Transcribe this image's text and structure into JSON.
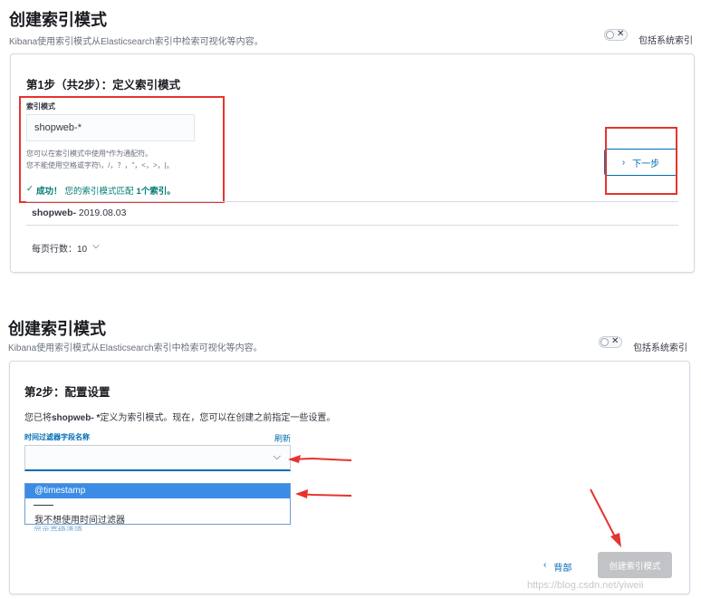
{
  "section1": {
    "title": "创建索引模式",
    "subtitle": "Kibana使用索引模式从Elasticsearch索引中检索可视化等内容。",
    "include_system_label": "包括系统索引",
    "step_title": "第1步（共2步）：定义索引模式",
    "field_label": "索引模式",
    "input_value": "shopweb-*",
    "help_line1": "您可以在索引模式中使用*作为通配符。",
    "help_line2": "您不能使用空格或字符\\，/，？，\"，<，>，|。",
    "success_prefix": "成功！",
    "success_text": "您的索引模式匹配",
    "success_bold": "1个索引。",
    "next_button": "下一步",
    "match_name": "shopweb-",
    "match_date": " 2019.08.03",
    "rows_per_page": "每页行数：10"
  },
  "section2": {
    "title": "创建索引模式",
    "subtitle": "Kibana使用索引模式从Elasticsearch索引中检索可视化等内容。",
    "include_system_label": "包括系统索引",
    "step_title": "第2步：配置设置",
    "desc_prefix": "您已将",
    "desc_bold": "shopweb- *",
    "desc_suffix": "定义为索引模式。现在，您可以在创建之前指定一些设置。",
    "field_label": "时间过滤器字段名称",
    "refresh_link": "刷新",
    "options": [
      "@timestamp",
      "我不想使用时间过滤器"
    ],
    "advanced_link": "显示高级选项",
    "back_button": "背部",
    "create_button": "创建索引模式"
  },
  "watermark": "https://blog.csdn.net/yiweii",
  "colors": {
    "accent": "#006bb4",
    "success": "#017d73",
    "annotation": "#e7332e",
    "highlight": "#3c8ce5"
  }
}
